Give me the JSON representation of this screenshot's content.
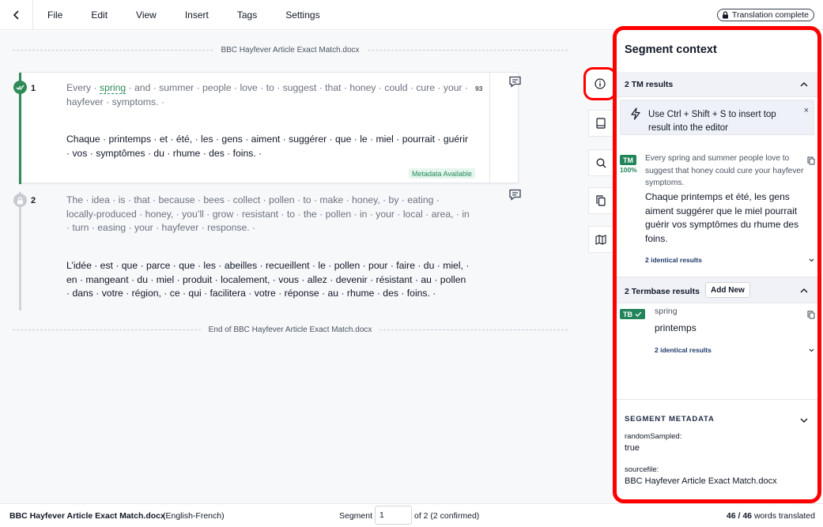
{
  "menu": {
    "items": [
      "File",
      "Edit",
      "View",
      "Insert",
      "Tags",
      "Settings"
    ],
    "status": "Translation complete"
  },
  "editor": {
    "doc_start": "BBC Hayfever Article Exact Match.docx",
    "doc_end": "End of BBC Hayfever Article Exact Match.docx",
    "segments": [
      {
        "number": "1",
        "status": "confirmed",
        "source_pre": "Every · ",
        "source_term": "spring",
        "source_post": " · and · summer · people · love · to · suggest · that · honey · could · cure · your · hayfever · symptoms. ·",
        "target": "Chaque · printemps · et · été, · les · gens · aiment · suggérer · que · le · miel · pourrait · guérir · vos · symptômes · du · rhume · des · foins. ·",
        "score": "93",
        "metadata_badge": "Metadata Available"
      },
      {
        "number": "2",
        "status": "locked",
        "source": "The · idea · is · that · because · bees · collect · pollen · to · make · honey, · by · eating · locally-produced · honey, · you’ll · grow · resistant · to · the · pollen · in · your · local · area, · in · turn · easing · your · hayfever · response. ·",
        "target": "L’idée · est · que · parce · que · les · abeilles · recueillent · le · pollen · pour · faire · du · miel, · en · mangeant · du · miel · produit · localement, · vous · allez · devenir · résistant · au · pollen · dans · votre · région, · ce · qui · facilitera · votre · réponse · au · rhume · des · foins. ·"
      }
    ]
  },
  "tools": [
    "info-icon",
    "book-icon",
    "search-icon",
    "copy-icon",
    "map-icon"
  ],
  "panel": {
    "title": "Segment context",
    "tm": {
      "header": "2 TM results",
      "hint": "Use Ctrl + Shift + S to insert top result into the editor",
      "close": "×",
      "tag": "TM",
      "match": "100%",
      "source": "Every spring and summer people love to suggest that honey could cure your hayfever symptoms.",
      "target": "Chaque printemps et été, les gens aiment suggérer que le miel pourrait guérir vos symptômes du rhume des foins.",
      "identical": "2 identical results"
    },
    "tb": {
      "header": "2 Termbase results",
      "add_new": "Add New",
      "tag": "TB",
      "source": "spring",
      "target": "printemps",
      "identical": "2 identical results"
    },
    "metadata": {
      "header": "SEGMENT METADATA",
      "key1": "randomSampled:",
      "val1": "true",
      "key2": "sourcefile:",
      "val2": "BBC Hayfever Article Exact Match.docx"
    }
  },
  "footer": {
    "file": "BBC Hayfever Article Exact Match.docx",
    "lang": "(English-French)",
    "segment_label": "Segment",
    "segment_value": "1",
    "of": "of 2 (2 confirmed)",
    "words_bold": "46 / 46",
    "words_rest": " words translated"
  },
  "colors": {
    "confirmed": "#2e8b57",
    "highlight": "#ff0000",
    "tag_green": "#21845a"
  }
}
